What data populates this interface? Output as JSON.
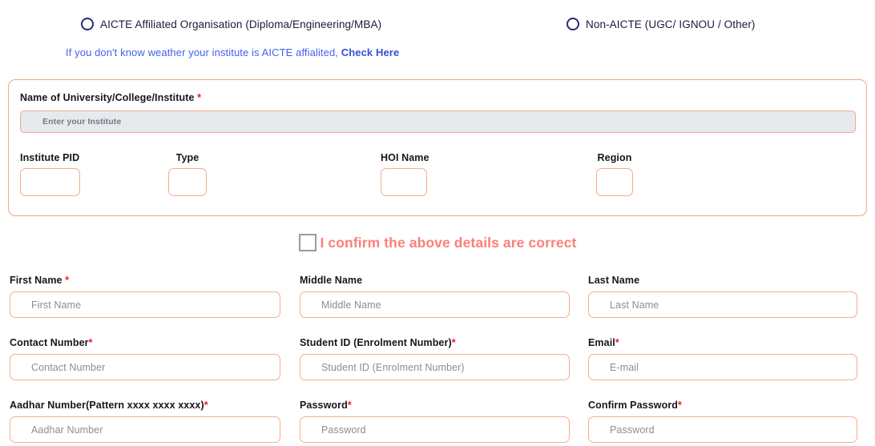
{
  "affiliation": {
    "options": [
      {
        "label": "AICTE Affiliated Organisation (Diploma/Engineering/MBA)",
        "selected": false
      },
      {
        "label": "Non-AICTE (UGC/ IGNOU / Other)",
        "selected": false
      }
    ]
  },
  "helper": {
    "text": "If you don't know weather your institute is AICTE affialited, ",
    "link_text": "Check Here"
  },
  "institute_panel": {
    "name_label": "Name of University/College/Institute",
    "name_required_mark": "*",
    "name_placeholder": "Enter your Institute",
    "name_value": "",
    "fields": [
      {
        "label": "Institute PID",
        "value": ""
      },
      {
        "label": "Type",
        "value": ""
      },
      {
        "label": "HOI Name",
        "value": ""
      },
      {
        "label": "Region",
        "value": ""
      }
    ]
  },
  "confirm": {
    "label": "I confirm the above details are correct",
    "checked": false
  },
  "form": {
    "rows": [
      [
        {
          "label": "First Name ",
          "required_mark": "*",
          "placeholder": "First Name",
          "value": ""
        },
        {
          "label": "Middle Name",
          "required_mark": "",
          "placeholder": "Middle Name",
          "value": ""
        },
        {
          "label": "Last Name",
          "required_mark": "",
          "placeholder": "Last Name",
          "value": ""
        }
      ],
      [
        {
          "label": "Contact Number",
          "required_mark": "*",
          "placeholder": "Contact Number",
          "value": ""
        },
        {
          "label": "Student ID (Enrolment Number)",
          "required_mark": "*",
          "placeholder": "Student ID (Enrolment Number)",
          "value": ""
        },
        {
          "label": "Email",
          "required_mark": "*",
          "placeholder": "E-mail",
          "value": ""
        }
      ],
      [
        {
          "label": "Aadhar Number(Pattern xxxx xxxx xxxx)",
          "required_mark": "*",
          "placeholder": "Aadhar Number",
          "value": ""
        },
        {
          "label": "Password",
          "required_mark": "*",
          "placeholder": "Password",
          "value": ""
        },
        {
          "label": "Confirm Password",
          "required_mark": "*",
          "placeholder": "Password",
          "value": ""
        }
      ]
    ]
  },
  "colors": {
    "field_border": "#f8ab92",
    "panel_border": "#f3a58b",
    "accent_coral": "#fb8178",
    "required_red": "#f01d1d",
    "link_blue": "#4361ee",
    "radio_ring": "#2a2a6e",
    "disabled_fill": "#e7eaed"
  }
}
